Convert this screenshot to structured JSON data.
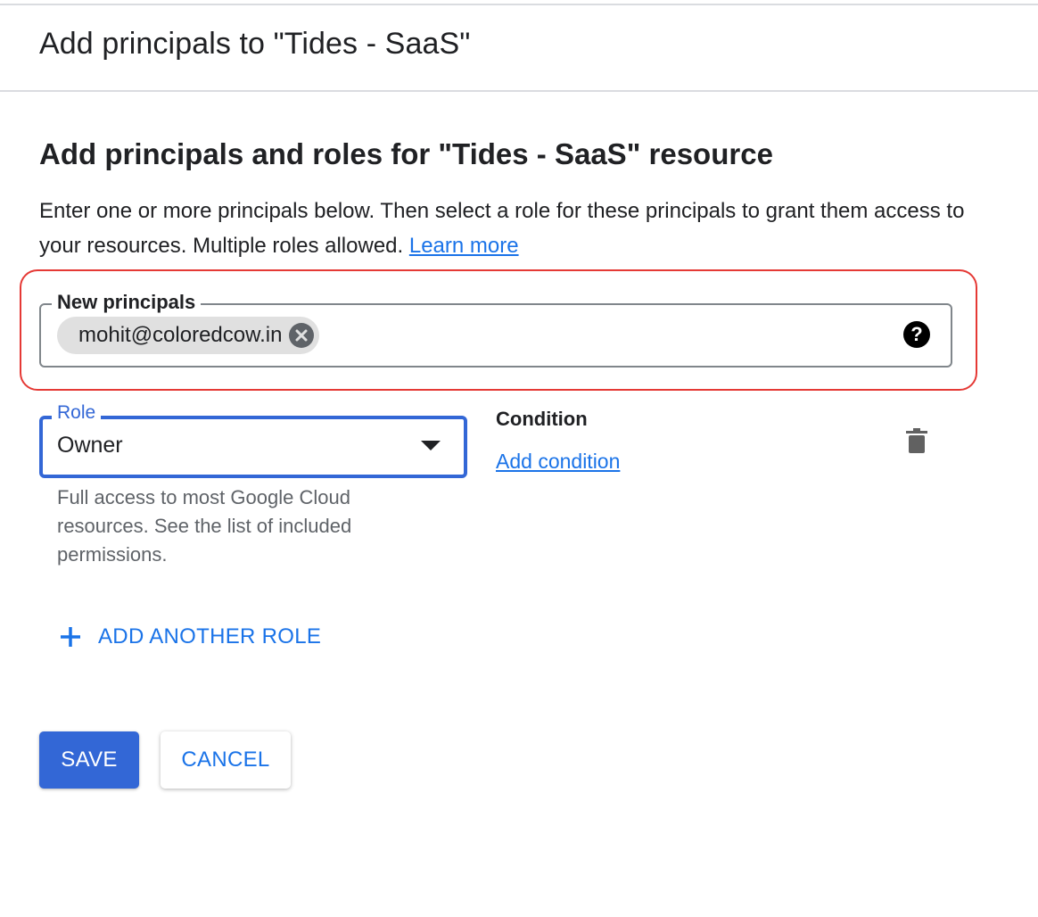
{
  "header": {
    "title": "Add principals to \"Tides - SaaS\""
  },
  "section": {
    "title": "Add principals and roles for \"Tides - SaaS\" resource",
    "description": "Enter one or more principals below. Then select a role for these principals to grant them access to your resources. Multiple roles allowed. ",
    "learn_more": "Learn more"
  },
  "principals": {
    "label": "New principals",
    "chips": [
      "mohit@coloredcow.in"
    ],
    "help_icon": "help-circle-icon"
  },
  "role": {
    "label": "Role",
    "value": "Owner",
    "description": "Full access to most Google Cloud resources. See the list of included permissions."
  },
  "condition": {
    "label": "Condition",
    "add_link": "Add condition"
  },
  "actions": {
    "add_role": "ADD ANOTHER ROLE",
    "save": "SAVE",
    "cancel": "CANCEL"
  },
  "colors": {
    "accent": "#1a73e8",
    "primary_button": "#3367d6",
    "highlight": "#e53935"
  }
}
